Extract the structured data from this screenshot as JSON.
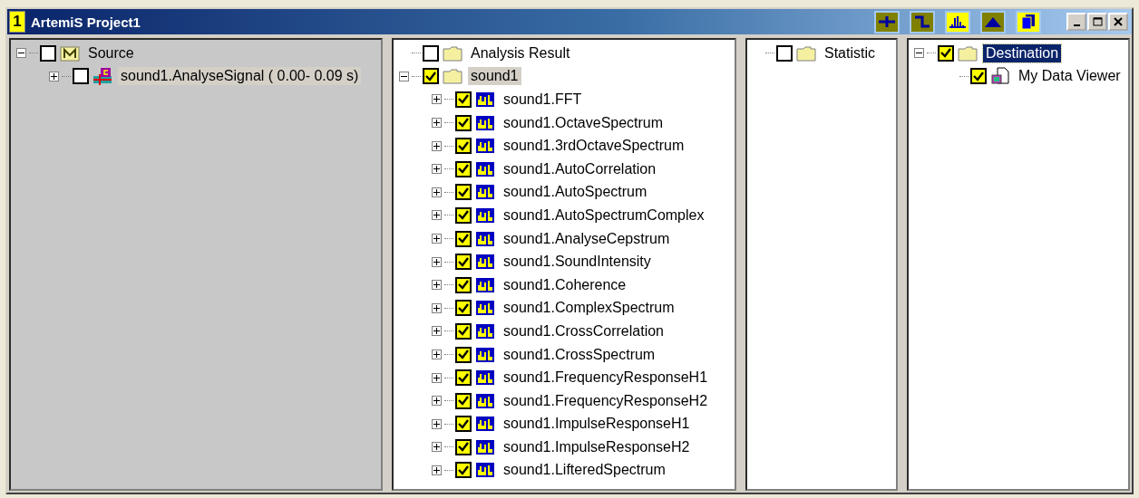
{
  "window": {
    "badge": "1",
    "title": "ArtemiS Project1"
  },
  "toolbar": [
    {
      "kind": "cross",
      "on": false
    },
    {
      "kind": "step",
      "on": false
    },
    {
      "kind": "spectrum",
      "on": true
    },
    {
      "kind": "peak",
      "on": false
    },
    {
      "kind": "pages",
      "on": true
    }
  ],
  "panes": [
    {
      "shade": true,
      "nodes": [
        {
          "label": "Source",
          "kind": "model",
          "checked": false,
          "selected": false,
          "expanded": true,
          "children": [
            {
              "label": "sound1.AnalyseSignal ( 0.00- 0.09 s)",
              "kind": "signal",
              "checked": false,
              "selected": true,
              "expanded": false
            }
          ]
        }
      ]
    },
    {
      "shade": false,
      "nodes": [
        {
          "label": "Analysis Result",
          "kind": "folder",
          "checked": false,
          "selected": false
        },
        {
          "label": "sound1",
          "kind": "folder",
          "checked": true,
          "selected": true,
          "expanded": true,
          "children": [
            {
              "label": "sound1.FFT",
              "kind": "spectrum",
              "checked": true,
              "selected": false,
              "expanded": false
            },
            {
              "label": "sound1.OctaveSpectrum",
              "kind": "spectrum",
              "checked": true,
              "selected": false,
              "expanded": false
            },
            {
              "label": "sound1.3rdOctaveSpectrum",
              "kind": "spectrum",
              "checked": true,
              "selected": false,
              "expanded": false
            },
            {
              "label": "sound1.AutoCorrelation",
              "kind": "spectrum",
              "checked": true,
              "selected": false,
              "expanded": false
            },
            {
              "label": "sound1.AutoSpectrum",
              "kind": "spectrum",
              "checked": true,
              "selected": false,
              "expanded": false
            },
            {
              "label": "sound1.AutoSpectrumComplex",
              "kind": "spectrum",
              "checked": true,
              "selected": false,
              "expanded": false
            },
            {
              "label": "sound1.AnalyseCepstrum",
              "kind": "spectrum",
              "checked": true,
              "selected": false,
              "expanded": false
            },
            {
              "label": "sound1.SoundIntensity",
              "kind": "spectrum",
              "checked": true,
              "selected": false,
              "expanded": false
            },
            {
              "label": "sound1.Coherence",
              "kind": "spectrum",
              "checked": true,
              "selected": false,
              "expanded": false
            },
            {
              "label": "sound1.ComplexSpectrum",
              "kind": "spectrum",
              "checked": true,
              "selected": false,
              "expanded": false
            },
            {
              "label": "sound1.CrossCorrelation",
              "kind": "spectrum",
              "checked": true,
              "selected": false,
              "expanded": false
            },
            {
              "label": "sound1.CrossSpectrum",
              "kind": "spectrum",
              "checked": true,
              "selected": false,
              "expanded": false
            },
            {
              "label": "sound1.FrequencyResponseH1",
              "kind": "spectrum",
              "checked": true,
              "selected": false,
              "expanded": false
            },
            {
              "label": "sound1.FrequencyResponseH2",
              "kind": "spectrum",
              "checked": true,
              "selected": false,
              "expanded": false
            },
            {
              "label": "sound1.ImpulseResponseH1",
              "kind": "spectrum",
              "checked": true,
              "selected": false,
              "expanded": false
            },
            {
              "label": "sound1.ImpulseResponseH2",
              "kind": "spectrum",
              "checked": true,
              "selected": false,
              "expanded": false
            },
            {
              "label": "sound1.LifteredSpectrum",
              "kind": "spectrum",
              "checked": true,
              "selected": false,
              "expanded": false
            }
          ]
        }
      ]
    },
    {
      "shade": false,
      "nodes": [
        {
          "label": "Statistic",
          "kind": "folder",
          "checked": false,
          "selected": false
        }
      ]
    },
    {
      "active": true,
      "shade": false,
      "nodes": [
        {
          "label": "Destination",
          "kind": "folder",
          "checked": true,
          "selected": true,
          "expanded": true,
          "children": [
            {
              "label": "My Data Viewer",
              "kind": "viewer",
              "checked": true,
              "selected": false
            }
          ]
        }
      ]
    }
  ]
}
